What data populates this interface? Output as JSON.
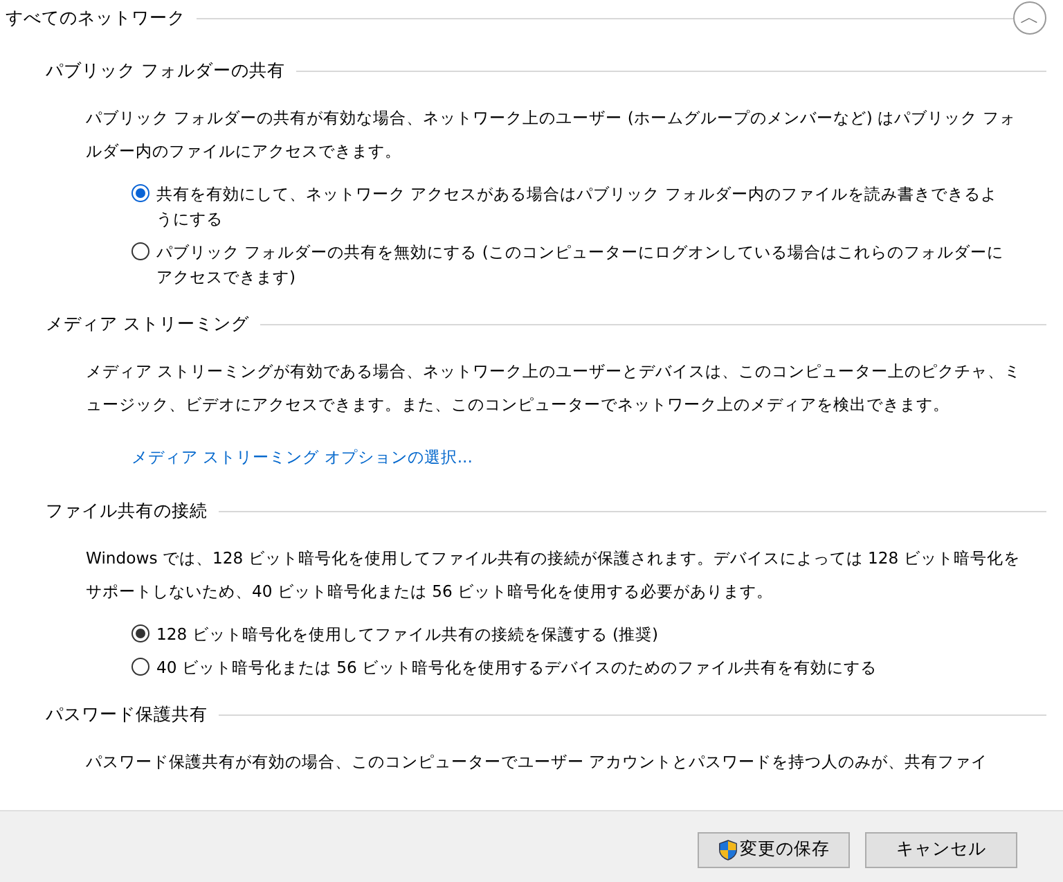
{
  "header": {
    "title": "すべてのネットワーク",
    "collapse_icon": "︿"
  },
  "sections": [
    {
      "title": "パブリック フォルダーの共有",
      "description": "パブリック フォルダーの共有が有効な場合、ネットワーク上のユーザー (ホームグループのメンバーなど) はパブリック フォルダー内のファイルにアクセスできます。",
      "options": [
        {
          "label": "共有を有効にして、ネットワーク アクセスがある場合はパブリック フォルダー内のファイルを読み書きできるようにする",
          "selected": true,
          "focused": true
        },
        {
          "label": "パブリック フォルダーの共有を無効にする (このコンピューターにログオンしている場合はこれらのフォルダーにアクセスできます)",
          "selected": false,
          "focused": false
        }
      ]
    },
    {
      "title": "メディア ストリーミング",
      "description": "メディア ストリーミングが有効である場合、ネットワーク上のユーザーとデバイスは、このコンピューター上のピクチャ、ミュージック、ビデオにアクセスできます。また、このコンピューターでネットワーク上のメディアを検出できます。",
      "link": "メディア ストリーミング オプションの選択..."
    },
    {
      "title": "ファイル共有の接続",
      "description": "Windows では、128 ビット暗号化を使用してファイル共有の接続が保護されます。デバイスによっては 128 ビット暗号化をサポートしないため、40 ビット暗号化または 56 ビット暗号化を使用する必要があります。",
      "options": [
        {
          "label": "128 ビット暗号化を使用してファイル共有の接続を保護する (推奨)",
          "selected": true,
          "focused": false
        },
        {
          "label": "40 ビット暗号化または 56 ビット暗号化を使用するデバイスのためのファイル共有を有効にする",
          "selected": false,
          "focused": false
        }
      ]
    },
    {
      "title": "パスワード保護共有",
      "description": "パスワード保護共有が有効の場合、このコンピューターでユーザー アカウントとパスワードを持つ人のみが、共有ファイ"
    }
  ],
  "buttons": [
    {
      "label": "変更の保存",
      "shield": true
    },
    {
      "label": "キャンセル",
      "shield": false
    }
  ]
}
